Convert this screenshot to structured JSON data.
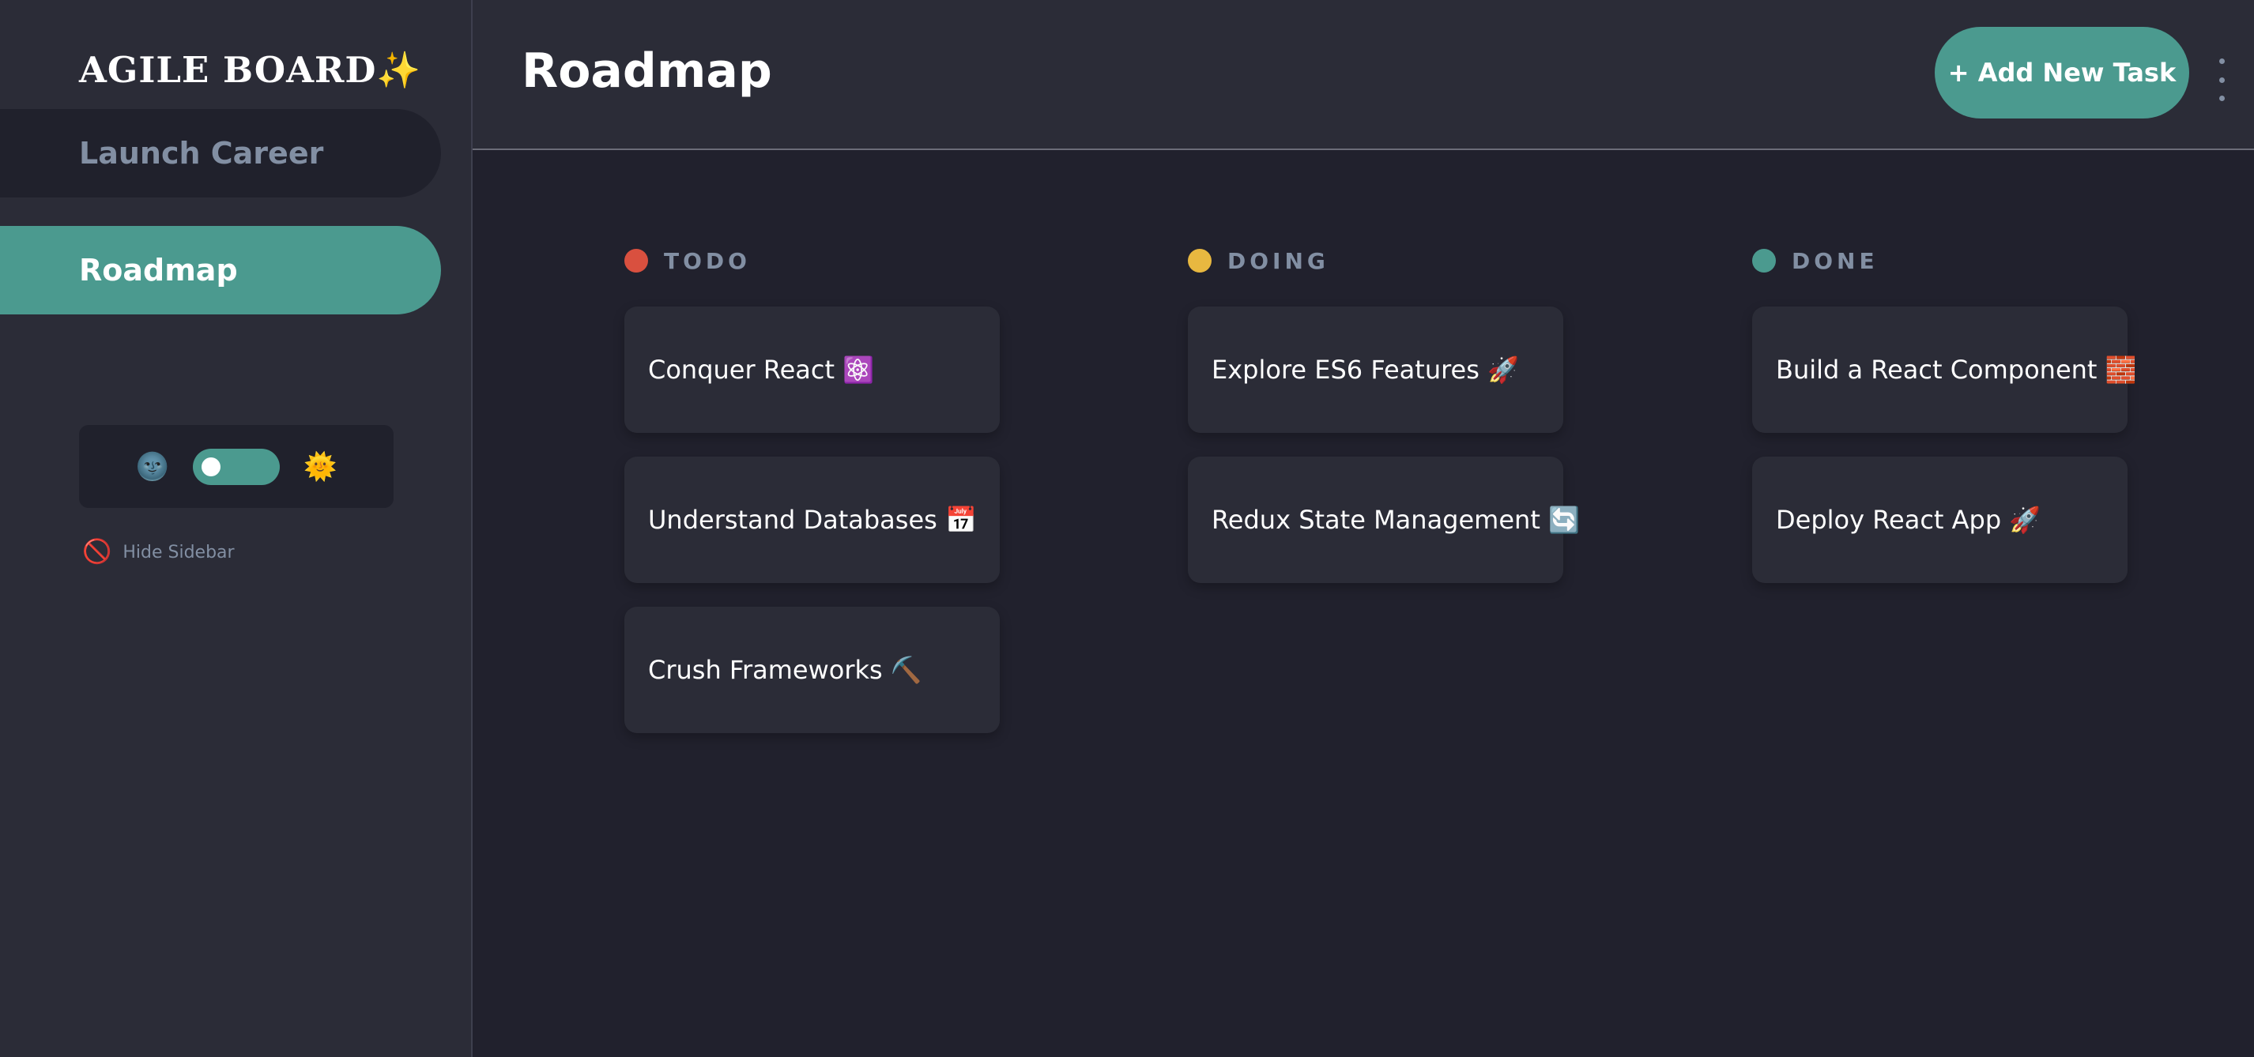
{
  "sidebar": {
    "logo": "AGILE BOARD✨",
    "boards": [
      {
        "label": "Launch Career"
      },
      {
        "label": "Roadmap"
      }
    ],
    "theme": {
      "dark_icon": "🌚",
      "light_icon": "🌞"
    },
    "hide_icon": "🚫",
    "hide_label": "Hide Sidebar"
  },
  "header": {
    "title": "Roadmap",
    "add_button": "+ Add New Task"
  },
  "columns": [
    {
      "name": "TODO",
      "color": "#d9503f",
      "tasks": [
        "Conquer React ⚛️",
        "Understand Databases 📅",
        "Crush Frameworks ⛏️"
      ]
    },
    {
      "name": "DOING",
      "color": "#e8b840",
      "tasks": [
        "Explore ES6 Features 🚀",
        "Redux State Management 🔄"
      ]
    },
    {
      "name": "DONE",
      "color": "#4b9a8f",
      "tasks": [
        "Build a React Component 🧱",
        "Deploy React App 🚀"
      ]
    }
  ],
  "colors": {
    "accent": "#4b9a8f",
    "background": "#21212d",
    "panel": "#2b2c37"
  }
}
